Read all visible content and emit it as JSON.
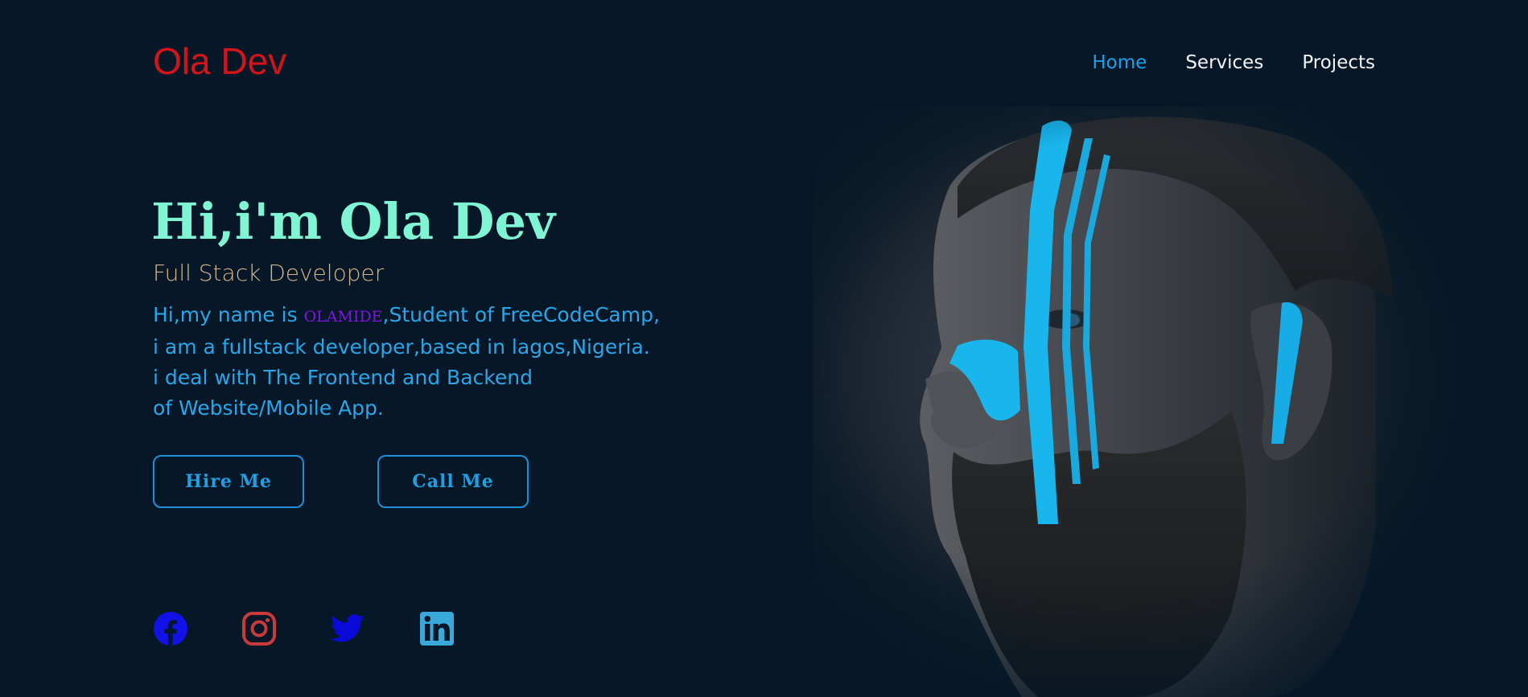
{
  "brand": {
    "logo_text": "Ola Dev",
    "logo_color": "#d4141a"
  },
  "nav": {
    "items": [
      {
        "label": "Home",
        "active": true
      },
      {
        "label": "Services",
        "active": false
      },
      {
        "label": "Projects",
        "active": false
      }
    ],
    "active_color": "#16a2ea"
  },
  "hero": {
    "headline": "Hi,i'm Ola Dev",
    "subtitle": "Full Stack Developer",
    "bio": {
      "line1_prefix": "Hi,my name is ",
      "name": "OLAMIDE",
      "line1_suffix": ",Student of FreeCodeCamp,",
      "line2": "i am a fullstack developer,based in lagos,Nigeria.",
      "line3": "i deal with The Frontend and Backend",
      "line4": "of Website/Mobile App."
    },
    "buttons": {
      "hire": "Hire Me",
      "call": "Call Me"
    },
    "photo_icon": "portrait-man-blue-face-paint"
  },
  "social": {
    "icons": [
      "facebook-icon",
      "instagram-icon",
      "twitter-icon",
      "linkedin-icon"
    ],
    "colors": {
      "facebook": "#1212e8",
      "instagram": "#c93a3a",
      "twitter": "#0a0ad8",
      "linkedin": "#39a9dc"
    }
  },
  "colors": {
    "background": "#061827",
    "headline": "#7ff5d4",
    "subtitle": "#d7b589",
    "bio": "#29a6ea",
    "name_highlight": "#7e14e6",
    "button_border": "#1c8fd6"
  }
}
